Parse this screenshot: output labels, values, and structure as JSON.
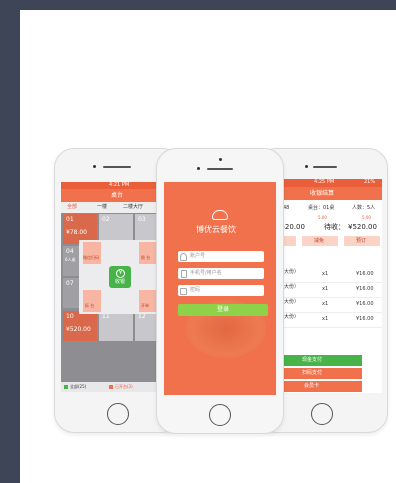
{
  "left_phone": {
    "status_time": "4:21 PM",
    "title": "桌台",
    "tabs": [
      "全部",
      "一楼",
      "二楼大厅"
    ],
    "tables": [
      {
        "id": "01",
        "price": "¥78.00"
      },
      {
        "id": "02"
      },
      {
        "id": "03"
      },
      {
        "id": "04"
      },
      {
        "id": "07"
      },
      {
        "id": "10",
        "price": "¥520.00"
      },
      {
        "id": "11"
      },
      {
        "id": "12"
      }
    ],
    "popup": {
      "center": "收银",
      "top_left": "微信扫码",
      "top_right": "换 台",
      "bottom_left": "拆 台",
      "bottom_right": "开单",
      "side": "6人桌"
    },
    "legend": [
      "全部(25)",
      "已开台(3)"
    ]
  },
  "center_phone": {
    "brand": "博优云餐饮",
    "fields": [
      {
        "placeholder": "账户号",
        "icon": "user-icon"
      },
      {
        "placeholder": "手机号/用户名",
        "icon": "phone-icon"
      },
      {
        "placeholder": "密码",
        "icon": "lock-icon"
      }
    ],
    "login_label": "登录",
    "colors": {
      "brand_orange": "#f0714c",
      "login_green": "#8ed24a"
    }
  },
  "right_phone": {
    "status_time": "4:25 PM",
    "status_battery": "21%",
    "title": "收银结算",
    "order_no": "T0212548",
    "table_info": "桌台：01桌",
    "people": "人数：5人",
    "sub_amounts": [
      "5.00",
      "5.00",
      "5.00"
    ],
    "total_prefix": "计：",
    "total": "¥520.00",
    "receivable_prefix": "待收：",
    "receivable": "¥520.00",
    "actions": [
      "折扣",
      "减免",
      "预订"
    ],
    "section": "品",
    "items": [
      {
        "name": "土豆丝（大份）",
        "qty": "x1",
        "price": "¥16.00"
      },
      {
        "name": "土豆丝（大份）",
        "qty": "x1",
        "price": "¥16.00"
      },
      {
        "name": "土豆丝（大份）",
        "qty": "x1",
        "price": "¥16.00"
      },
      {
        "name": "土豆丝（大份）",
        "qty": "x1",
        "price": "¥16.00"
      }
    ],
    "pay_buttons": [
      "现金支付",
      "扫码支付",
      "会员卡"
    ]
  }
}
